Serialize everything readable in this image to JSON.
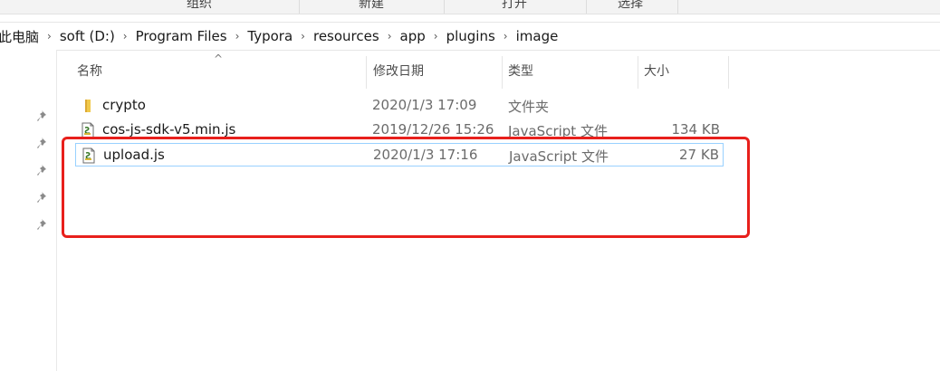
{
  "ribbon": {
    "groups": [
      "组织",
      "新建",
      "打开",
      "选择"
    ]
  },
  "address": {
    "crumbs": [
      "此电脑",
      "soft (D:)",
      "Program Files",
      "Typora",
      "resources",
      "app",
      "plugins",
      "image"
    ]
  },
  "columns": {
    "name": "名称",
    "date": "修改日期",
    "type": "类型",
    "size": "大小"
  },
  "files": [
    {
      "name": "crypto",
      "date": "2020/1/3 17:09",
      "type": "文件夹",
      "size": "",
      "icon": "folder-icon"
    },
    {
      "name": "cos-js-sdk-v5.min.js",
      "date": "2019/12/26 15:26",
      "type": "JavaScript 文件",
      "size": "134 KB",
      "icon": "js-file-icon"
    },
    {
      "name": "upload.js",
      "date": "2020/1/3 17:16",
      "type": "JavaScript 文件",
      "size": "27 KB",
      "icon": "js-file-icon"
    }
  ],
  "colors": {
    "highlight_border": "#e8201c",
    "selection_border": "#99d1ff"
  }
}
